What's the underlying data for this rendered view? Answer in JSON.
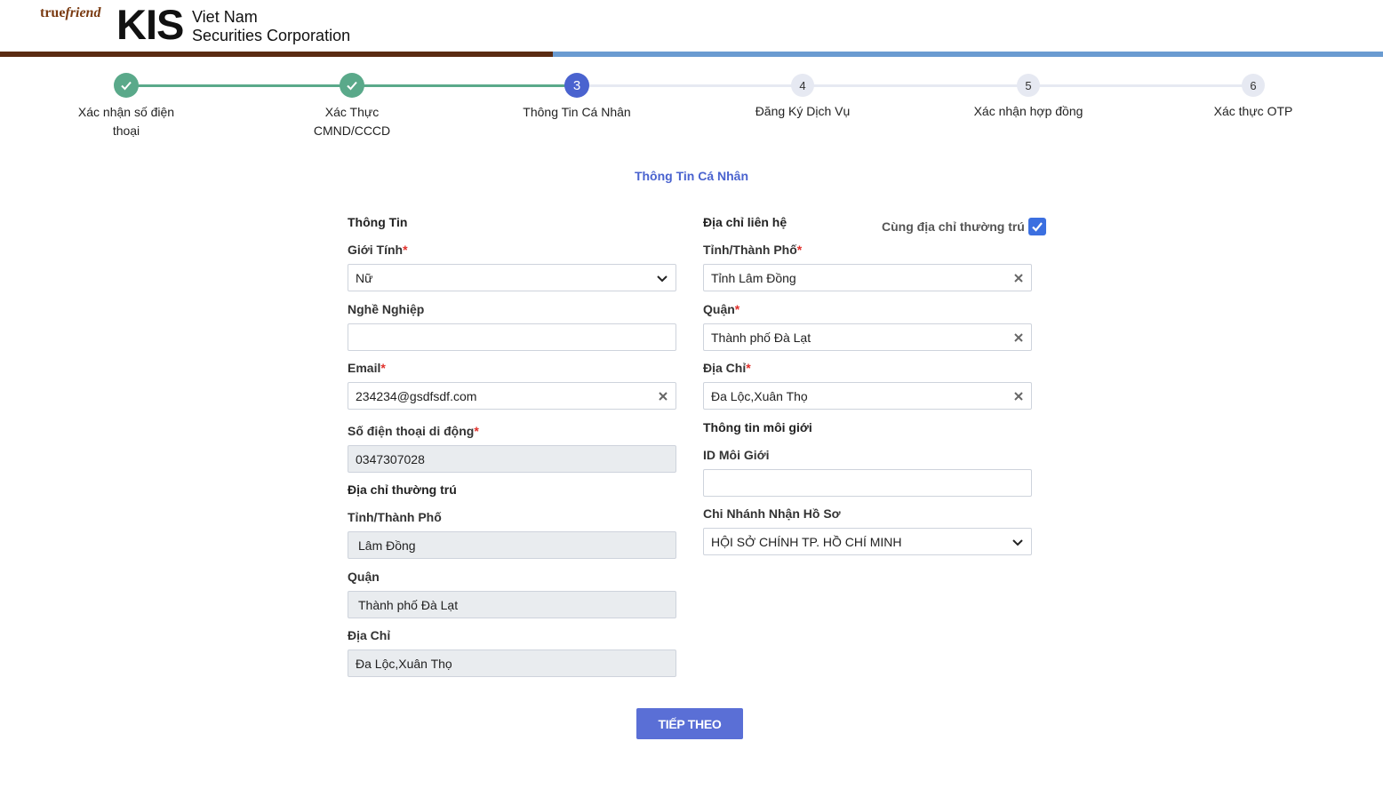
{
  "brand": {
    "true_part": "true",
    "friend_part": "friend",
    "kis": "KIS",
    "line1": "Viet Nam",
    "line2": "Securities Corporation"
  },
  "progress": {
    "fraction": 0.4
  },
  "steps": [
    {
      "number": "1",
      "label_line1": "Xác nhận số điện",
      "label_line2": "thoại",
      "state": "done"
    },
    {
      "number": "2",
      "label_line1": "Xác Thực",
      "label_line2": "CMND/CCCD",
      "state": "done"
    },
    {
      "number": "3",
      "label_line1": "Thông Tin Cá Nhân",
      "label_line2": "",
      "state": "active"
    },
    {
      "number": "4",
      "label_line1": "Đăng Ký Dịch Vụ",
      "label_line2": "",
      "state": "todo"
    },
    {
      "number": "5",
      "label_line1": "Xác nhận hợp đồng",
      "label_line2": "",
      "state": "todo"
    },
    {
      "number": "6",
      "label_line1": "Xác thực OTP",
      "label_line2": "",
      "state": "todo"
    }
  ],
  "page_title": "Thông Tin Cá Nhân",
  "left": {
    "heading": "Thông Tin",
    "gender_label": "Giới Tính",
    "gender_value": "Nữ",
    "job_label": "Nghề Nghiệp",
    "job_value": "",
    "email_label": "Email",
    "email_value": "234234@gsdfsdf.com",
    "phone_label": "Số điện thoại di động",
    "phone_value": "0347307028",
    "perm_heading": "Địa chỉ thường trú",
    "perm_city_label": "Tỉnh/Thành Phố",
    "perm_city_value": "Lâm Đồng",
    "perm_district_label": "Quận",
    "perm_district_value": "Thành phố Đà Lạt",
    "perm_address_label": "Địa Chỉ",
    "perm_address_value": "Đa Lộc,Xuân Thọ"
  },
  "right": {
    "heading": "Địa chỉ liên hệ",
    "same_address_label": "Cùng địa chỉ thường trú",
    "same_address_checked": true,
    "city_label": "Tỉnh/Thành Phố",
    "city_value": "Tỉnh Lâm Đồng",
    "district_label": "Quận",
    "district_value": "Thành phố Đà Lạt",
    "address_label": "Địa Chỉ",
    "address_value": "Đa Lộc,Xuân Thọ",
    "broker_heading": "Thông tin môi giới",
    "broker_id_label": "ID Môi Giới",
    "broker_id_value": "",
    "branch_label": "Chi Nhánh Nhận Hồ Sơ",
    "branch_value": "HỘI SỞ CHÍNH TP. HỒ CHÍ MINH"
  },
  "required_mark": "*",
  "next_button": "TIẾP THEO",
  "colors": {
    "accent": "#4a63cf",
    "done": "#5aa98a",
    "brand_brown": "#5a2b12",
    "progress_blue": "#6a9bd1",
    "required": "#e0302b",
    "checkbox": "#3b6fe0"
  }
}
